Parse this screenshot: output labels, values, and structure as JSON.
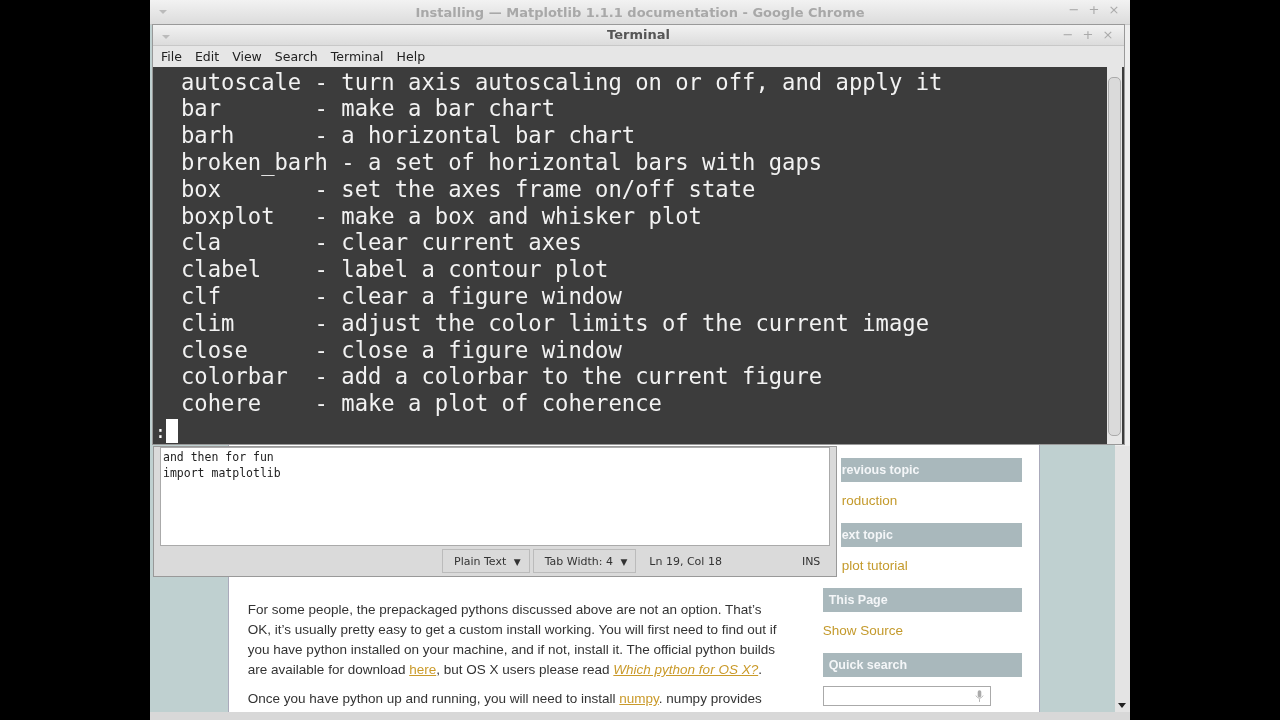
{
  "browser": {
    "title": "Installing — Matplotlib 1.1.1 documentation - Google Chrome",
    "controls": [
      "−",
      "+",
      "×"
    ]
  },
  "page": {
    "paragraphs": [
      [
        {
          "text": "For some people, the prepackaged pythons discussed above are not an option. That’s OK, it’s usually pretty easy to get a custom install working. You will first need to find out if you have python installed on your machine, and if not, install it. The official python builds are available for download ",
          "link": false,
          "italic": false
        },
        {
          "text": "here",
          "link": true,
          "italic": false
        },
        {
          "text": ", but OS X users please read ",
          "link": false,
          "italic": false
        },
        {
          "text": "Which python for OS X?",
          "link": true,
          "italic": true
        },
        {
          "text": ".",
          "link": false,
          "italic": false
        }
      ],
      [
        {
          "text": "Once you have python up and running, you will need to install ",
          "link": false,
          "italic": false
        },
        {
          "text": "numpy",
          "link": true,
          "italic": false
        },
        {
          "text": ". numpy provides",
          "link": false,
          "italic": false
        }
      ]
    ],
    "sidebar": [
      {
        "kind": "header",
        "text": "revious topic"
      },
      {
        "kind": "link",
        "text": "roduction"
      },
      {
        "kind": "header",
        "text": "ext topic"
      },
      {
        "kind": "link",
        "text": "plot tutorial"
      },
      {
        "kind": "header",
        "text": "This Page"
      },
      {
        "kind": "link",
        "text": "Show Source"
      },
      {
        "kind": "header",
        "text": "Quick search"
      },
      {
        "kind": "search"
      }
    ]
  },
  "terminal": {
    "title": "Terminal",
    "controls": [
      "−",
      "+",
      "×"
    ],
    "menu": [
      "File",
      "Edit",
      "View",
      "Search",
      "Terminal",
      "Help"
    ],
    "lines": [
      "autoscale - turn axis autoscaling on or off, and apply it",
      "bar       - make a bar chart",
      "barh      - a horizontal bar chart",
      "broken_barh - a set of horizontal bars with gaps",
      "box       - set the axes frame on/off state",
      "boxplot   - make a box and whisker plot",
      "cla       - clear current axes",
      "clabel    - label a contour plot",
      "clf       - clear a figure window",
      "clim      - adjust the color limits of the current image",
      "close     - close a figure window",
      "colorbar  - add a colorbar to the current figure",
      "cohere    - make a plot of coherence"
    ],
    "prompt": ":"
  },
  "editor": {
    "lines": [
      "and then for fun",
      "import matplotlib"
    ],
    "status": [
      {
        "kind": "dropdown",
        "text": "Plain Text",
        "caret": "▼"
      },
      {
        "kind": "dropdown",
        "text": "Tab Width:  4",
        "caret": "▼"
      },
      {
        "kind": "label",
        "text": "Ln 19, Col 18"
      },
      {
        "kind": "label",
        "text": "INS"
      }
    ]
  }
}
